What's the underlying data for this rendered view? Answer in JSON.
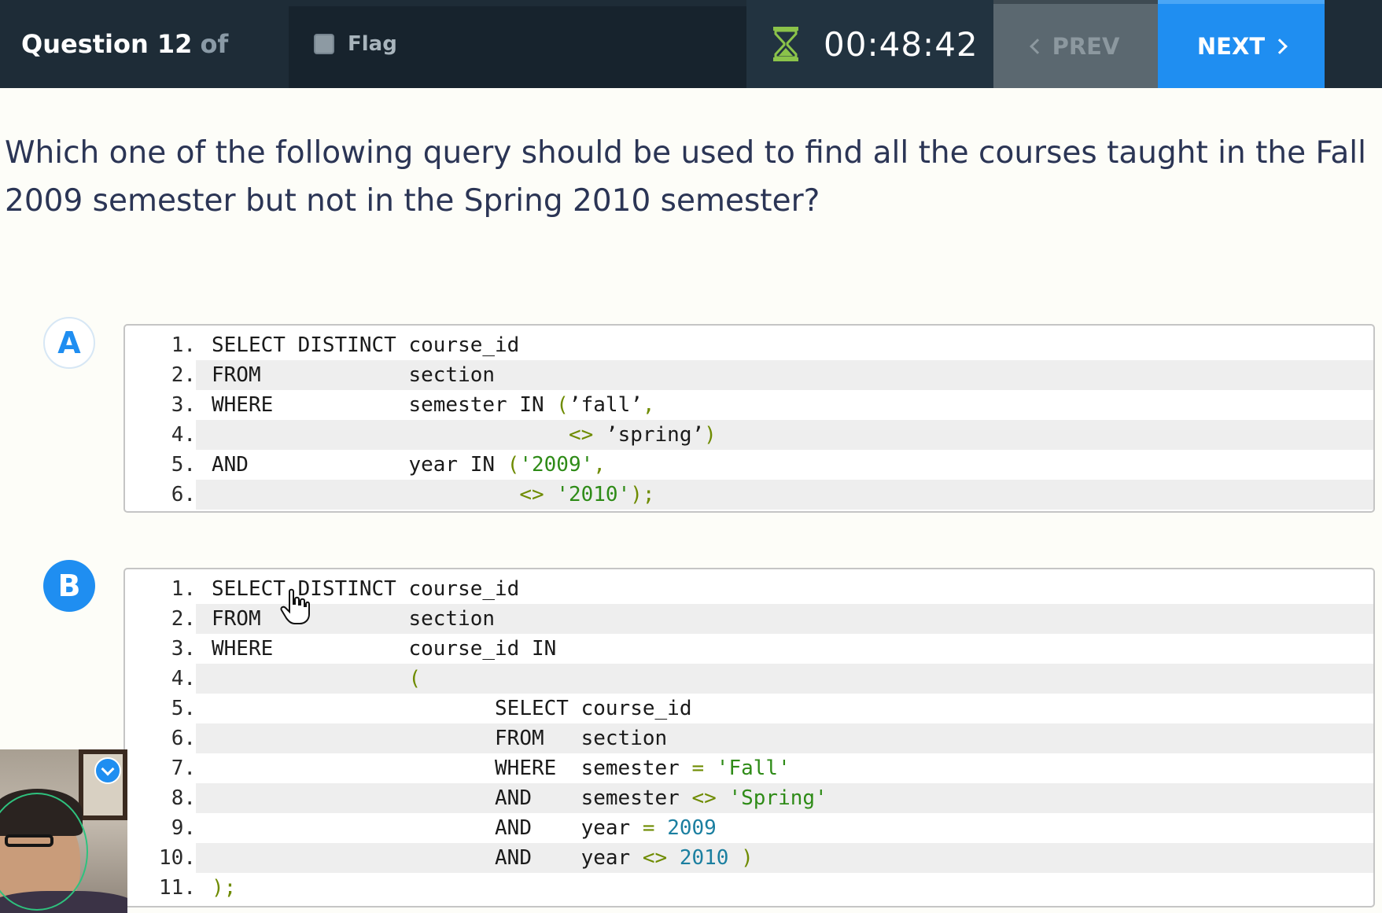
{
  "header": {
    "question_label": "Question 12",
    "question_of": "of",
    "flag_label": "Flag",
    "timer": "00:48:42",
    "prev_label": "PREV",
    "next_label": "NEXT"
  },
  "question": {
    "text": "Which one of the following query should be used to find all the courses taught in the Fall 2009 semester but not in the Spring 2010 semester?"
  },
  "options": [
    {
      "letter": "A",
      "selected": false,
      "lines": [
        {
          "num": "1.",
          "code": "SELECT DISTINCT course_id"
        },
        {
          "num": "2.",
          "code": "FROM            section"
        },
        {
          "num": "3.",
          "code": "WHERE           semester IN (’fall’,"
        },
        {
          "num": "4.",
          "code": "                             <> ’spring’)"
        },
        {
          "num": "5.",
          "code": "AND             year IN ('2009',"
        },
        {
          "num": "6.",
          "code": "                         <> '2010');"
        }
      ]
    },
    {
      "letter": "B",
      "selected": true,
      "lines": [
        {
          "num": "1.",
          "code": "SELECT DISTINCT course_id"
        },
        {
          "num": "2.",
          "code": "FROM            section"
        },
        {
          "num": "3.",
          "code": "WHERE           course_id IN"
        },
        {
          "num": "4.",
          "code": "                ("
        },
        {
          "num": "5.",
          "code": "                       SELECT course_id"
        },
        {
          "num": "6.",
          "code": "                       FROM   section"
        },
        {
          "num": "7.",
          "code": "                       WHERE  semester = 'Fall'"
        },
        {
          "num": "8.",
          "code": "                       AND    semester <> 'Spring'"
        },
        {
          "num": "9.",
          "code": "                       AND    year = 2009"
        },
        {
          "num": "10.",
          "code": "                       AND    year <> 2010 )"
        },
        {
          "num": "11.",
          "code": ");"
        }
      ]
    }
  ],
  "colors": {
    "accent": "#1f8ef1",
    "topbar": "#1e2c37",
    "timer_icon": "#8bc34a",
    "string": "#2e8b17",
    "number": "#1b7fa0",
    "operator": "#6e8b00"
  },
  "icons": {
    "timer": "hourglass-icon",
    "prev": "chevron-left-icon",
    "next": "chevron-right-icon",
    "flag": "checkbox-icon",
    "webcam_badge": "check-badge-icon"
  }
}
